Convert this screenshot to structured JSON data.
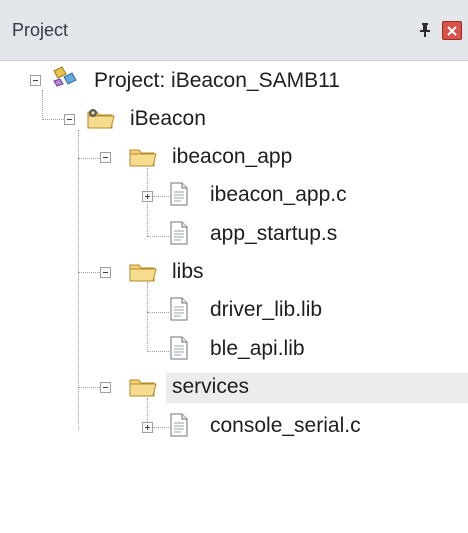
{
  "panel": {
    "title": "Project",
    "pin_icon": "pin-icon",
    "close_icon": "close-icon",
    "accent_close": "#d9534a"
  },
  "tree": {
    "project_label": "Project: iBeacon_SAMB11",
    "target_label": "iBeacon",
    "groups": [
      {
        "label": "ibeacon_app",
        "files": [
          "ibeacon_app.c",
          "app_startup.s"
        ]
      },
      {
        "label": "libs",
        "files": [
          "driver_lib.lib",
          "ble_api.lib"
        ]
      },
      {
        "label": "services",
        "files": [
          "console_serial.c"
        ]
      }
    ],
    "selected_group": "services"
  }
}
